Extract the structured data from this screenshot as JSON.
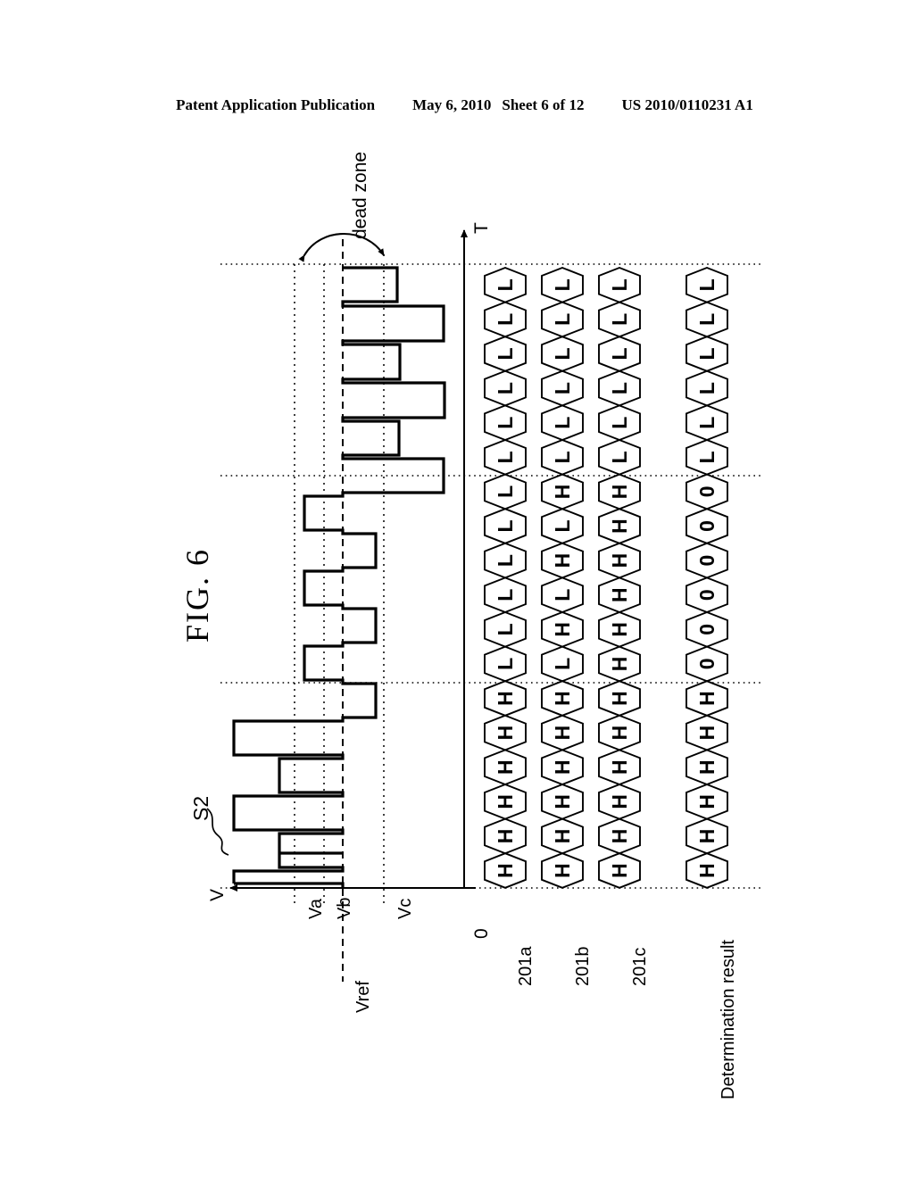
{
  "header": {
    "publication": "Patent Application Publication",
    "date": "May 6, 2010",
    "sheet": "Sheet 6 of 12",
    "patent_number": "US 2010/0110231 A1"
  },
  "figure": {
    "title": "FIG. 6",
    "annotations": {
      "dead_zone": "dead zone",
      "signal": "S2",
      "axis_time": "T",
      "axis_voltage": "V",
      "origin": "0"
    },
    "threshold_labels": [
      "Va",
      "Vb",
      "Vref",
      "Vc"
    ],
    "row_labels": [
      "201a",
      "201b",
      "201c",
      "Determination result"
    ]
  },
  "chart_data": {
    "type": "timing-diagram",
    "title": "FIG. 6",
    "xlabel": "T",
    "ylabel": "V",
    "description": "Square-wave signal S2 compared against thresholds Va, Vb, Vc around Vref; three comparator outputs 201a/201b/201c and a combined determination result, shown as hexagon cell rows.",
    "thresholds": [
      {
        "name": "Va",
        "style": "dotted"
      },
      {
        "name": "Vb",
        "style": "dotted"
      },
      {
        "name": "Vref",
        "style": "dashed"
      },
      {
        "name": "Vc",
        "style": "dotted"
      }
    ],
    "dead_zone": {
      "label": "dead zone",
      "between": [
        "Va",
        "Vc"
      ]
    },
    "waveform": {
      "name": "S2",
      "segments": [
        {
          "level": "Vc_plus_small",
          "note": "above Vc"
        },
        {
          "level": "Vc_plus_large",
          "note": "well above Vc"
        },
        {
          "level": "Vc_plus_small",
          "note": "above Vc"
        },
        {
          "level": "Vc_plus_large",
          "note": "well above Vc"
        },
        {
          "level": "Vc_plus_small",
          "note": "above Vc"
        },
        {
          "level": "Vc_plus_large",
          "note": "well above Vc"
        },
        {
          "level": "Vb_minus",
          "note": "inside dead zone, below Vref"
        },
        {
          "level": "Vc_inner",
          "note": "inside dead zone, above Vref"
        },
        {
          "level": "Vb_minus",
          "note": "inside dead zone, below Vref"
        },
        {
          "level": "Vc_inner",
          "note": "inside dead zone, above Vref"
        },
        {
          "level": "Vb_minus",
          "note": "inside dead zone, below Vref"
        },
        {
          "level": "Vc_inner",
          "note": "inside dead zone, above Vref"
        },
        {
          "level": "Va_large",
          "note": "well below Va"
        },
        {
          "level": "Va_small",
          "note": "below Vb"
        },
        {
          "level": "Va_large",
          "note": "well below Va"
        },
        {
          "level": "Va_small",
          "note": "below Vb"
        },
        {
          "level": "Va_large",
          "note": "well below Va"
        },
        {
          "level": "Va_small",
          "note": "below Vb"
        }
      ]
    },
    "rows": [
      {
        "label": "201a",
        "cells": [
          "L",
          "L",
          "L",
          "L",
          "L",
          "L",
          "L",
          "L",
          "L",
          "L",
          "L",
          "L",
          "H",
          "H",
          "H",
          "H",
          "H",
          "H"
        ]
      },
      {
        "label": "201b",
        "cells": [
          "L",
          "L",
          "L",
          "L",
          "L",
          "L",
          "H",
          "L",
          "H",
          "L",
          "H",
          "L",
          "H",
          "H",
          "H",
          "H",
          "H",
          "H"
        ]
      },
      {
        "label": "201c",
        "cells": [
          "L",
          "L",
          "L",
          "L",
          "L",
          "L",
          "H",
          "H",
          "H",
          "H",
          "H",
          "H",
          "H",
          "H",
          "H",
          "H",
          "H",
          "H"
        ]
      },
      {
        "label": "Determination result",
        "cells": [
          "L",
          "L",
          "L",
          "L",
          "L",
          "L",
          "0",
          "0",
          "0",
          "0",
          "0",
          "0",
          "H",
          "H",
          "H",
          "H",
          "H",
          "H"
        ]
      }
    ]
  }
}
